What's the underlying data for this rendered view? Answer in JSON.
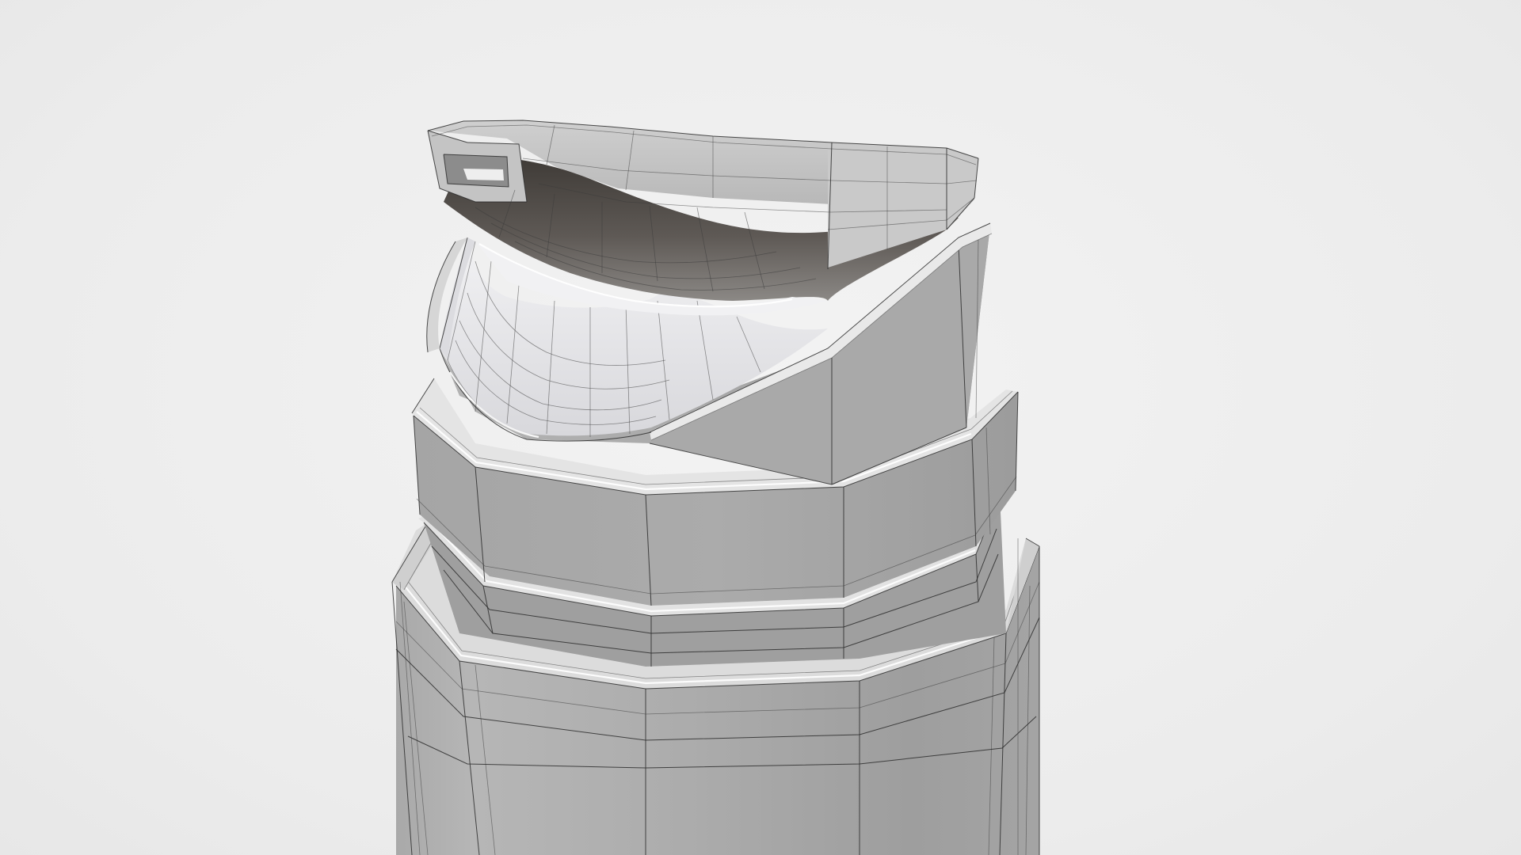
{
  "scene": {
    "subject": "bottle-pump-cap-wireframe",
    "colors": {
      "background": "#ececec",
      "surface_light": "#b9b9b9",
      "surface_mid": "#9d9d9d",
      "surface_dark": "#7a7a7a",
      "surface_shadow": "#4a4642",
      "bevel": "#e9e9e9",
      "wire": "#2d2d2d"
    }
  }
}
